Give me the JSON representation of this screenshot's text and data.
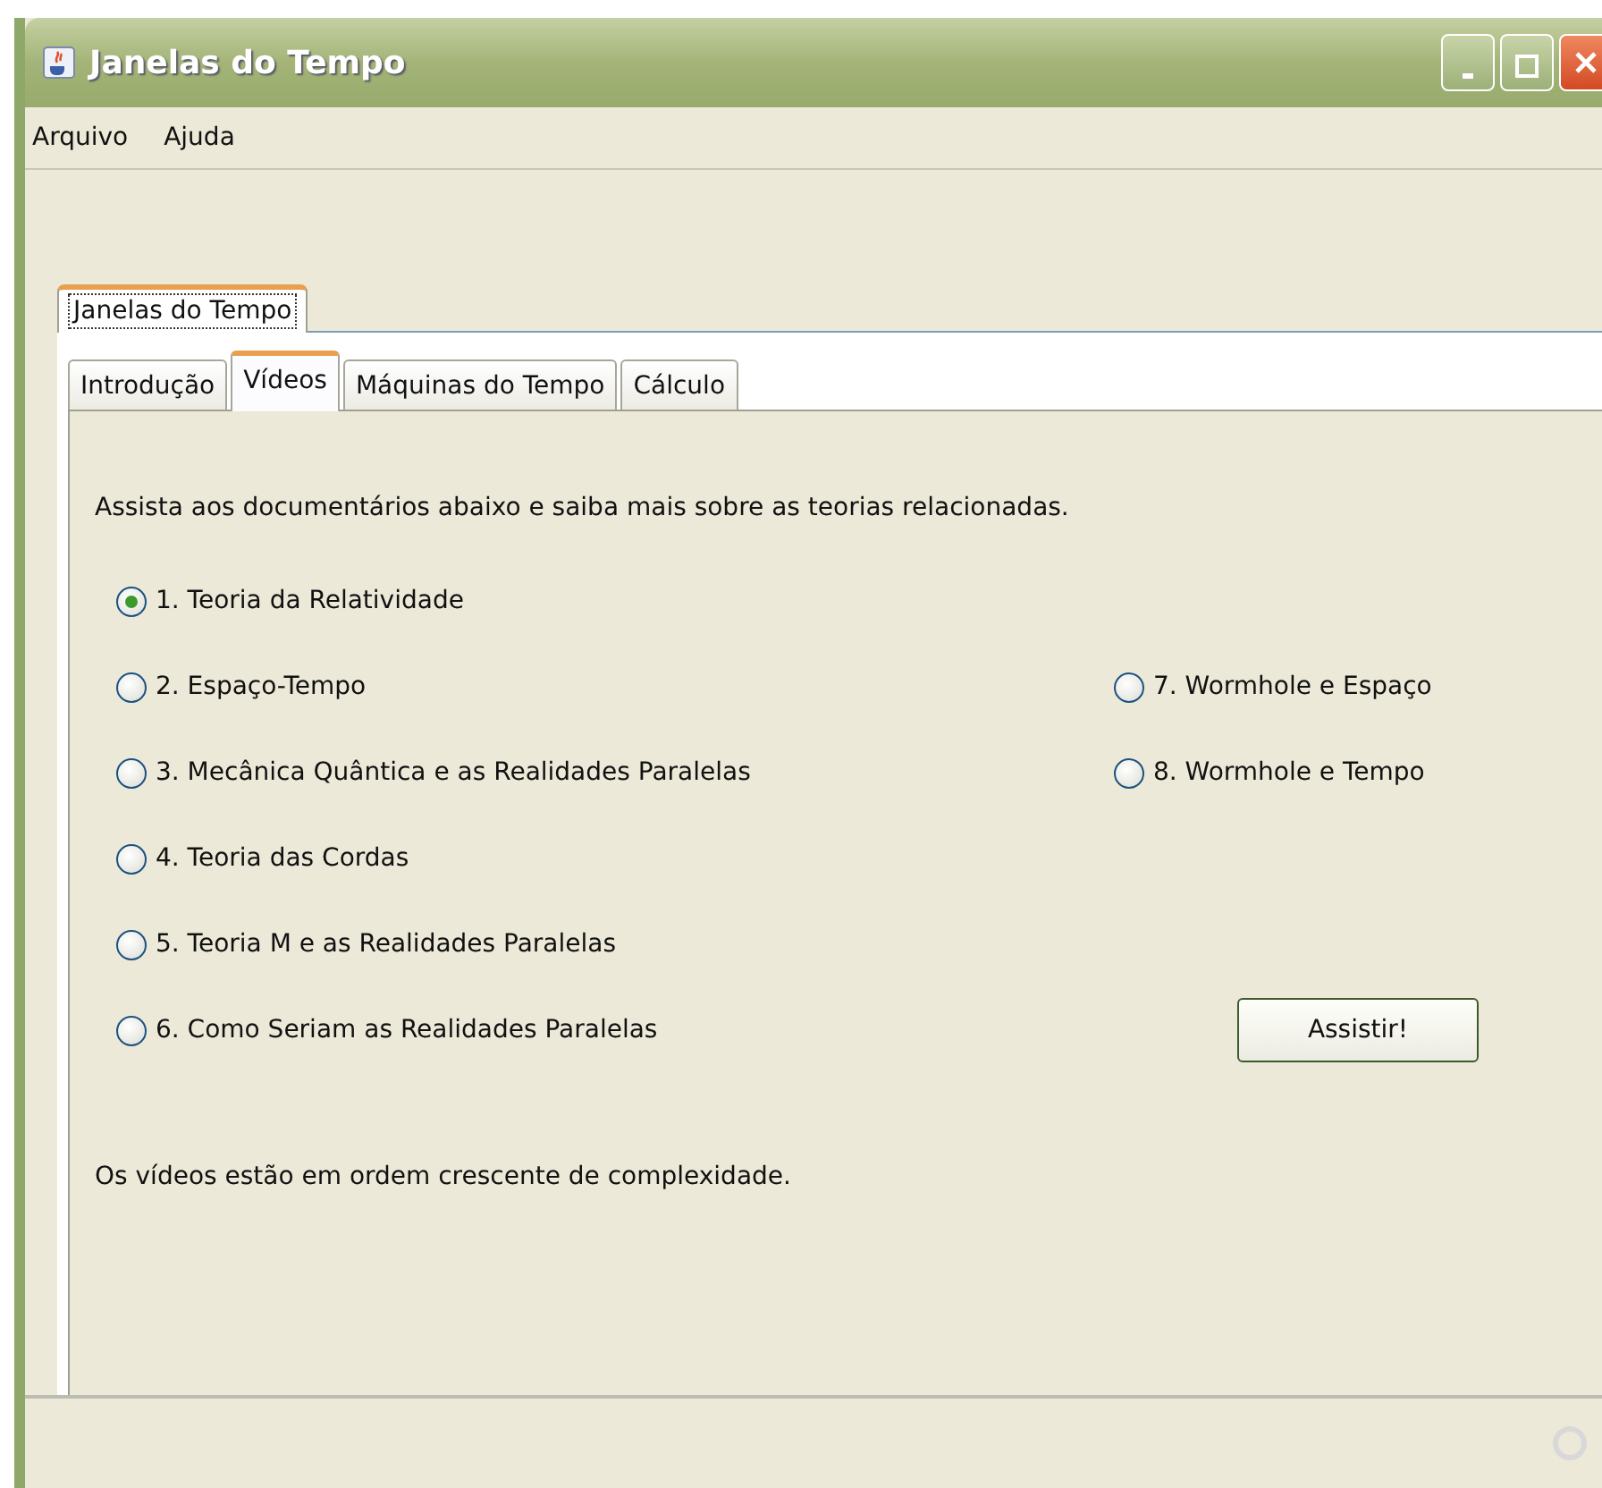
{
  "window": {
    "title": "Janelas do Tempo"
  },
  "menu": [
    "Arquivo",
    "Ajuda"
  ],
  "outer_tabs": [
    {
      "label": "Janelas do Tempo",
      "selected": true
    }
  ],
  "tabs": [
    {
      "label": "Introdução",
      "selected": false
    },
    {
      "label": "Vídeos",
      "selected": true
    },
    {
      "label": "Máquinas do Tempo",
      "selected": false
    },
    {
      "label": "Cálculo",
      "selected": false
    }
  ],
  "intro": "Assista aos documentários abaixo e saiba mais sobre as teorias relacionadas.",
  "left_options": [
    {
      "label": "1. Teoria da Relatividade",
      "selected": true
    },
    {
      "label": "2. Espaço-Tempo",
      "selected": false
    },
    {
      "label": "3. Mecânica Quântica e as Realidades Paralelas",
      "selected": false
    },
    {
      "label": "4. Teoria das Cordas",
      "selected": false
    },
    {
      "label": "5. Teoria M e as Realidades Paralelas",
      "selected": false
    },
    {
      "label": "6. Como Seriam as Realidades Paralelas",
      "selected": false
    }
  ],
  "right_options": [
    {
      "label": "7. Wormhole e Espaço",
      "selected": false
    },
    {
      "label": "8. Wormhole e Tempo",
      "selected": false
    }
  ],
  "button": "Assistir!",
  "note": "Os vídeos estão em ordem crescente de complexidade."
}
